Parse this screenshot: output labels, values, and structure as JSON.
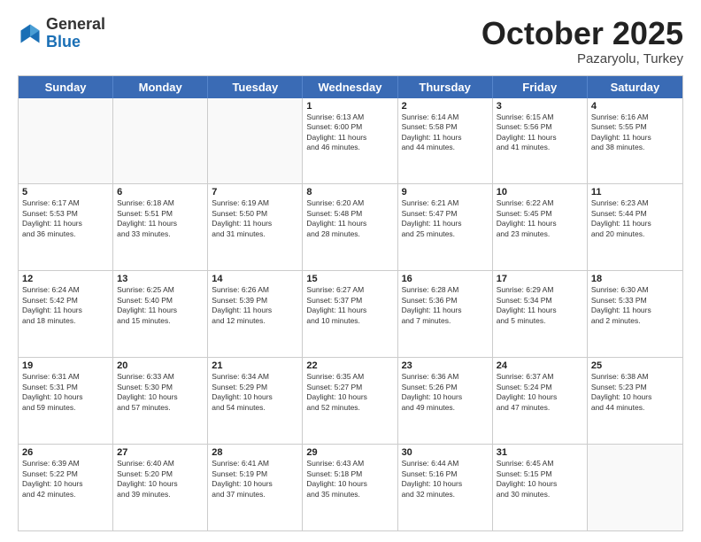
{
  "header": {
    "logo_general": "General",
    "logo_blue": "Blue",
    "month": "October 2025",
    "location": "Pazaryolu, Turkey"
  },
  "days_of_week": [
    "Sunday",
    "Monday",
    "Tuesday",
    "Wednesday",
    "Thursday",
    "Friday",
    "Saturday"
  ],
  "weeks": [
    [
      {
        "day": "",
        "lines": []
      },
      {
        "day": "",
        "lines": []
      },
      {
        "day": "",
        "lines": []
      },
      {
        "day": "1",
        "lines": [
          "Sunrise: 6:13 AM",
          "Sunset: 6:00 PM",
          "Daylight: 11 hours",
          "and 46 minutes."
        ]
      },
      {
        "day": "2",
        "lines": [
          "Sunrise: 6:14 AM",
          "Sunset: 5:58 PM",
          "Daylight: 11 hours",
          "and 44 minutes."
        ]
      },
      {
        "day": "3",
        "lines": [
          "Sunrise: 6:15 AM",
          "Sunset: 5:56 PM",
          "Daylight: 11 hours",
          "and 41 minutes."
        ]
      },
      {
        "day": "4",
        "lines": [
          "Sunrise: 6:16 AM",
          "Sunset: 5:55 PM",
          "Daylight: 11 hours",
          "and 38 minutes."
        ]
      }
    ],
    [
      {
        "day": "5",
        "lines": [
          "Sunrise: 6:17 AM",
          "Sunset: 5:53 PM",
          "Daylight: 11 hours",
          "and 36 minutes."
        ]
      },
      {
        "day": "6",
        "lines": [
          "Sunrise: 6:18 AM",
          "Sunset: 5:51 PM",
          "Daylight: 11 hours",
          "and 33 minutes."
        ]
      },
      {
        "day": "7",
        "lines": [
          "Sunrise: 6:19 AM",
          "Sunset: 5:50 PM",
          "Daylight: 11 hours",
          "and 31 minutes."
        ]
      },
      {
        "day": "8",
        "lines": [
          "Sunrise: 6:20 AM",
          "Sunset: 5:48 PM",
          "Daylight: 11 hours",
          "and 28 minutes."
        ]
      },
      {
        "day": "9",
        "lines": [
          "Sunrise: 6:21 AM",
          "Sunset: 5:47 PM",
          "Daylight: 11 hours",
          "and 25 minutes."
        ]
      },
      {
        "day": "10",
        "lines": [
          "Sunrise: 6:22 AM",
          "Sunset: 5:45 PM",
          "Daylight: 11 hours",
          "and 23 minutes."
        ]
      },
      {
        "day": "11",
        "lines": [
          "Sunrise: 6:23 AM",
          "Sunset: 5:44 PM",
          "Daylight: 11 hours",
          "and 20 minutes."
        ]
      }
    ],
    [
      {
        "day": "12",
        "lines": [
          "Sunrise: 6:24 AM",
          "Sunset: 5:42 PM",
          "Daylight: 11 hours",
          "and 18 minutes."
        ]
      },
      {
        "day": "13",
        "lines": [
          "Sunrise: 6:25 AM",
          "Sunset: 5:40 PM",
          "Daylight: 11 hours",
          "and 15 minutes."
        ]
      },
      {
        "day": "14",
        "lines": [
          "Sunrise: 6:26 AM",
          "Sunset: 5:39 PM",
          "Daylight: 11 hours",
          "and 12 minutes."
        ]
      },
      {
        "day": "15",
        "lines": [
          "Sunrise: 6:27 AM",
          "Sunset: 5:37 PM",
          "Daylight: 11 hours",
          "and 10 minutes."
        ]
      },
      {
        "day": "16",
        "lines": [
          "Sunrise: 6:28 AM",
          "Sunset: 5:36 PM",
          "Daylight: 11 hours",
          "and 7 minutes."
        ]
      },
      {
        "day": "17",
        "lines": [
          "Sunrise: 6:29 AM",
          "Sunset: 5:34 PM",
          "Daylight: 11 hours",
          "and 5 minutes."
        ]
      },
      {
        "day": "18",
        "lines": [
          "Sunrise: 6:30 AM",
          "Sunset: 5:33 PM",
          "Daylight: 11 hours",
          "and 2 minutes."
        ]
      }
    ],
    [
      {
        "day": "19",
        "lines": [
          "Sunrise: 6:31 AM",
          "Sunset: 5:31 PM",
          "Daylight: 10 hours",
          "and 59 minutes."
        ]
      },
      {
        "day": "20",
        "lines": [
          "Sunrise: 6:33 AM",
          "Sunset: 5:30 PM",
          "Daylight: 10 hours",
          "and 57 minutes."
        ]
      },
      {
        "day": "21",
        "lines": [
          "Sunrise: 6:34 AM",
          "Sunset: 5:29 PM",
          "Daylight: 10 hours",
          "and 54 minutes."
        ]
      },
      {
        "day": "22",
        "lines": [
          "Sunrise: 6:35 AM",
          "Sunset: 5:27 PM",
          "Daylight: 10 hours",
          "and 52 minutes."
        ]
      },
      {
        "day": "23",
        "lines": [
          "Sunrise: 6:36 AM",
          "Sunset: 5:26 PM",
          "Daylight: 10 hours",
          "and 49 minutes."
        ]
      },
      {
        "day": "24",
        "lines": [
          "Sunrise: 6:37 AM",
          "Sunset: 5:24 PM",
          "Daylight: 10 hours",
          "and 47 minutes."
        ]
      },
      {
        "day": "25",
        "lines": [
          "Sunrise: 6:38 AM",
          "Sunset: 5:23 PM",
          "Daylight: 10 hours",
          "and 44 minutes."
        ]
      }
    ],
    [
      {
        "day": "26",
        "lines": [
          "Sunrise: 6:39 AM",
          "Sunset: 5:22 PM",
          "Daylight: 10 hours",
          "and 42 minutes."
        ]
      },
      {
        "day": "27",
        "lines": [
          "Sunrise: 6:40 AM",
          "Sunset: 5:20 PM",
          "Daylight: 10 hours",
          "and 39 minutes."
        ]
      },
      {
        "day": "28",
        "lines": [
          "Sunrise: 6:41 AM",
          "Sunset: 5:19 PM",
          "Daylight: 10 hours",
          "and 37 minutes."
        ]
      },
      {
        "day": "29",
        "lines": [
          "Sunrise: 6:43 AM",
          "Sunset: 5:18 PM",
          "Daylight: 10 hours",
          "and 35 minutes."
        ]
      },
      {
        "day": "30",
        "lines": [
          "Sunrise: 6:44 AM",
          "Sunset: 5:16 PM",
          "Daylight: 10 hours",
          "and 32 minutes."
        ]
      },
      {
        "day": "31",
        "lines": [
          "Sunrise: 6:45 AM",
          "Sunset: 5:15 PM",
          "Daylight: 10 hours",
          "and 30 minutes."
        ]
      },
      {
        "day": "",
        "lines": []
      }
    ]
  ]
}
